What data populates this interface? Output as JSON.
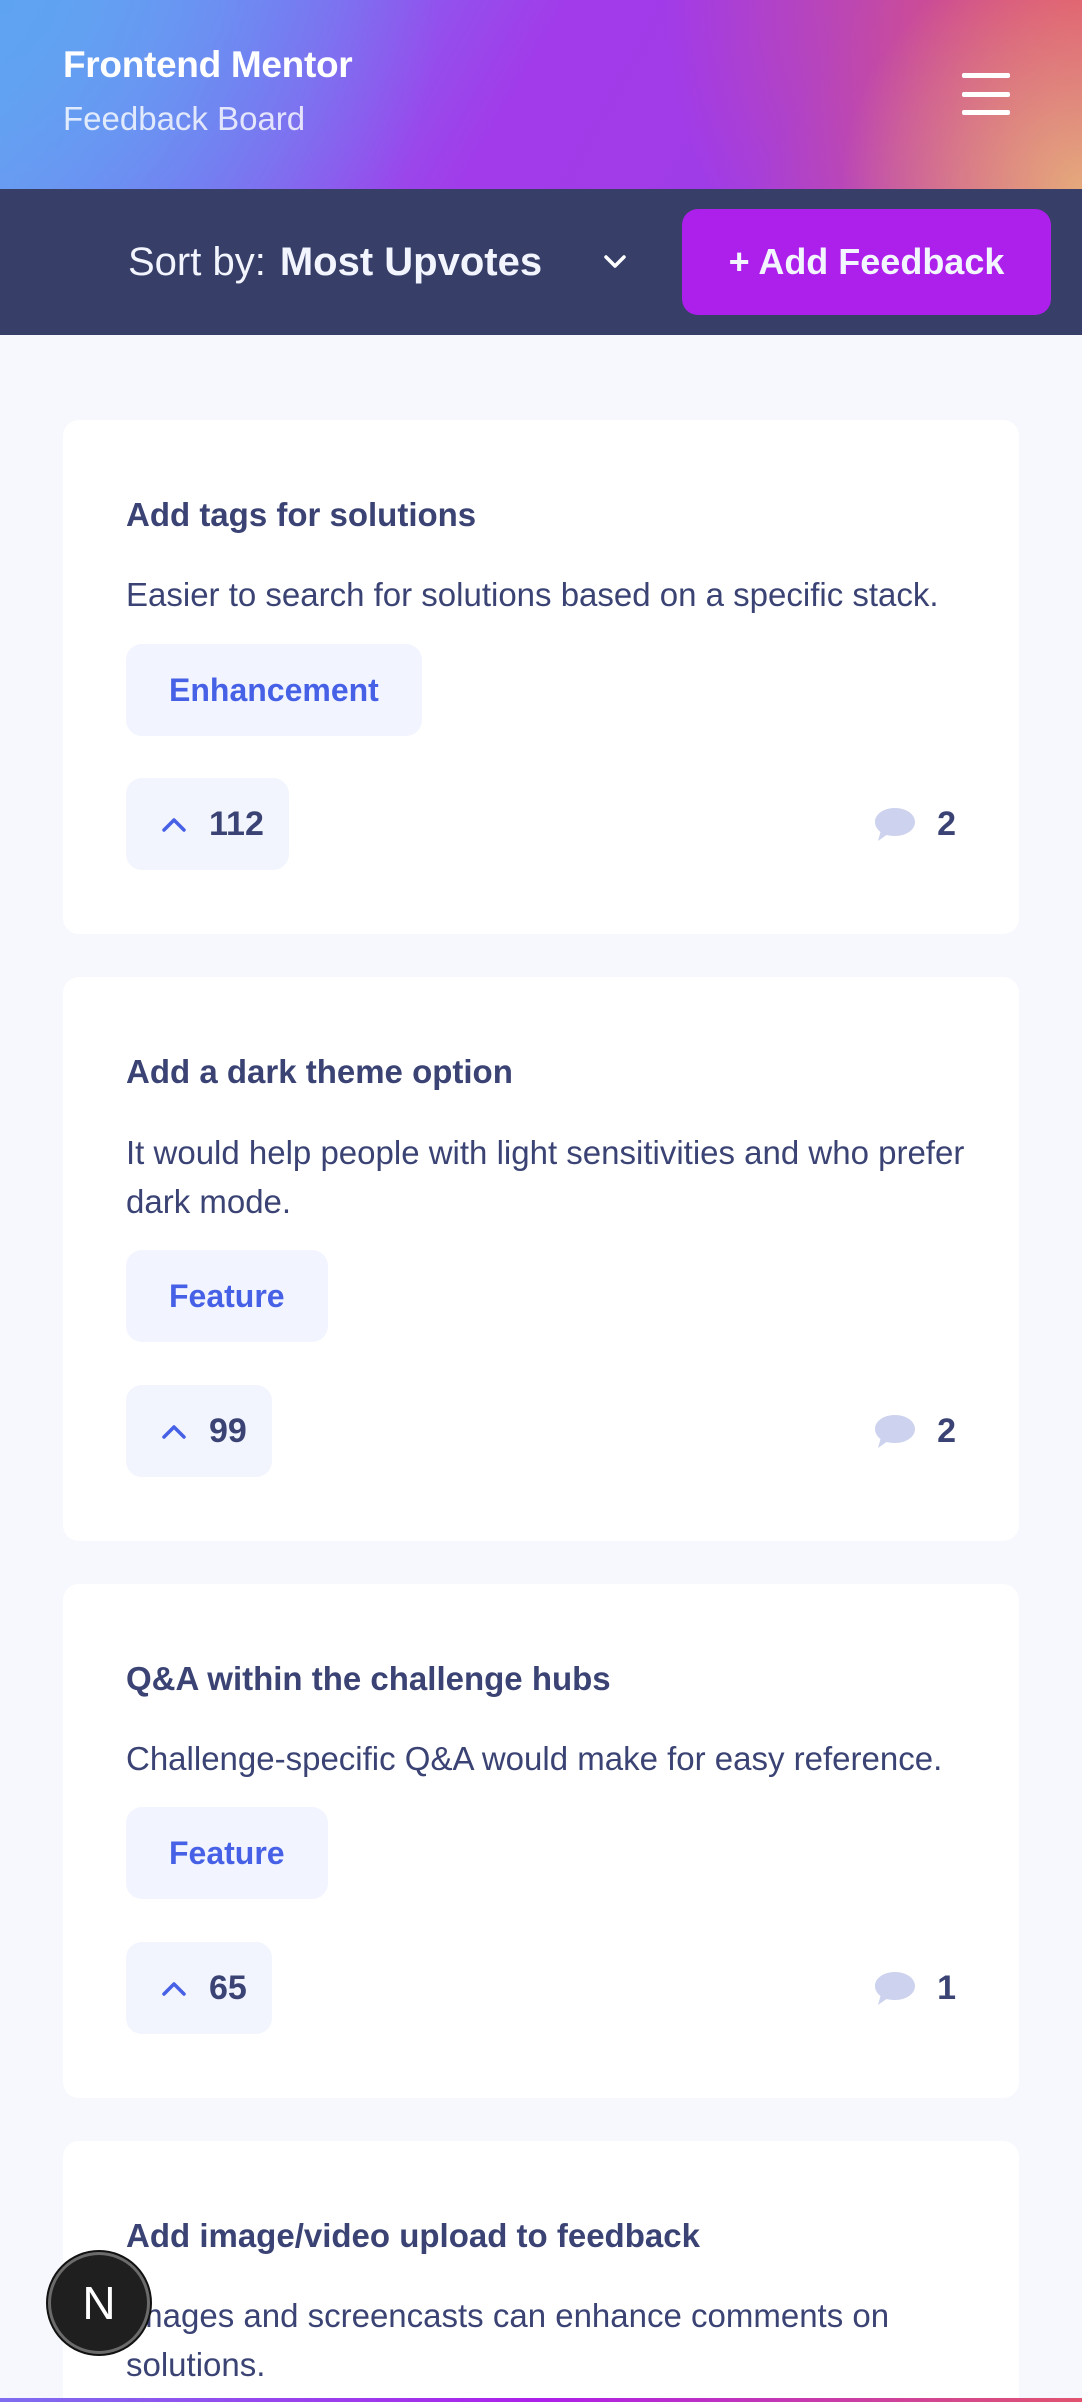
{
  "header": {
    "title": "Frontend Mentor",
    "subtitle": "Feedback Board",
    "menu_icon": "hamburger-icon"
  },
  "toolbar": {
    "sort_label": "Sort by:",
    "sort_value": "Most Upvotes",
    "add_label": "+ Add Feedback"
  },
  "feedback": [
    {
      "title": "Add tags for solutions",
      "description": "Easier to search for solutions based on a specific stack.",
      "category": "Enhancement",
      "upvotes": "112",
      "comments": "2"
    },
    {
      "title": "Add a dark theme option",
      "description": "It would help people with light sensitivities and who prefer dark mode.",
      "category": "Feature",
      "upvotes": "99",
      "comments": "2"
    },
    {
      "title": "Q&A within the challenge hubs",
      "description": "Challenge-specific Q&A would make for easy reference.",
      "category": "Feature",
      "upvotes": "65",
      "comments": "1"
    },
    {
      "title": "Add image/video upload to feedback",
      "description": "Images and screencasts can enhance comments on solutions."
    }
  ],
  "fab": {
    "label": "N"
  },
  "colors": {
    "accent": "#ad1fea",
    "sortbar": "#373f68",
    "tag_text": "#4661e6",
    "text": "#3a4374",
    "background": "#f7f8fd"
  }
}
